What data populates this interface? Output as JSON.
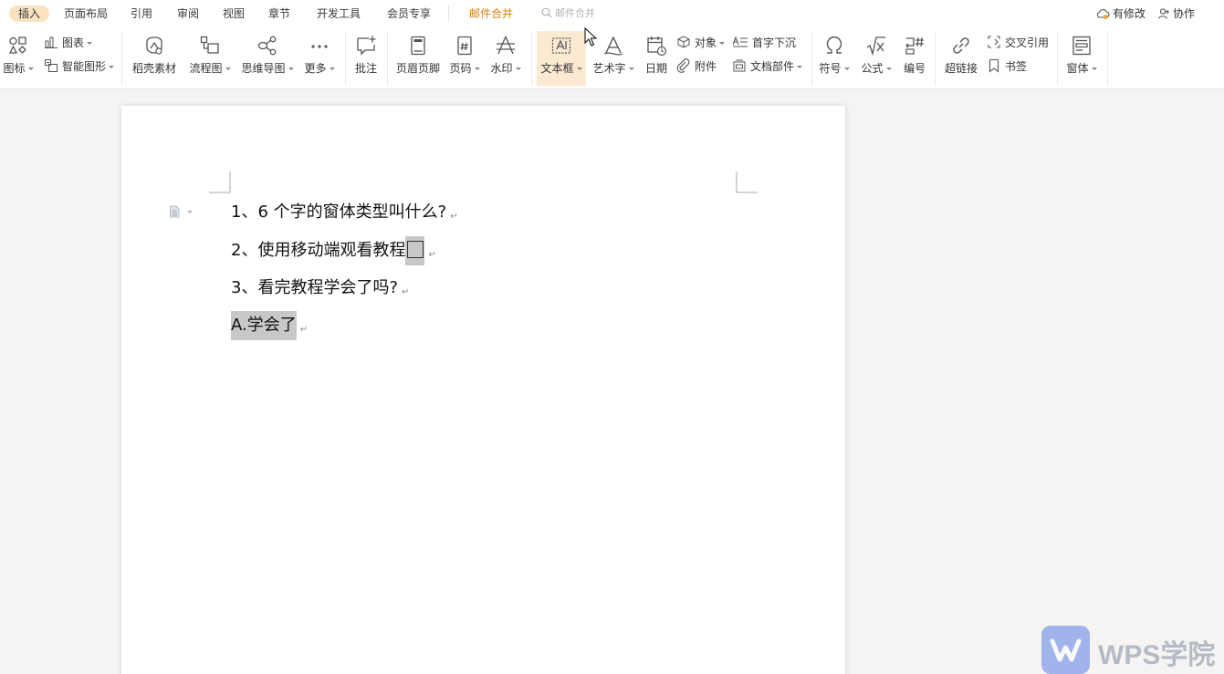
{
  "menu": {
    "tabs": [
      {
        "label": "插入",
        "active": true
      },
      {
        "label": "页面布局"
      },
      {
        "label": "引用"
      },
      {
        "label": "审阅"
      },
      {
        "label": "视图"
      },
      {
        "label": "章节"
      },
      {
        "label": "开发工具"
      },
      {
        "label": "会员专享"
      },
      {
        "label": "邮件合并",
        "accent": true
      }
    ],
    "search_placeholder": "邮件合并",
    "modified_label": "有修改",
    "collab_label": "协作"
  },
  "ribbon": {
    "icon_label": "图标",
    "chart_label": "图表",
    "smartart_label": "智能图形",
    "docer_label": "稻壳素材",
    "flowchart_label": "流程图",
    "mindmap_label": "思维导图",
    "more_label": "更多",
    "comment_label": "批注",
    "header_footer_label": "页眉页脚",
    "page_number_label": "页码",
    "watermark_label": "水印",
    "textbox_label": "文本框",
    "wordart_label": "艺术字",
    "date_label": "日期",
    "object_label": "对象",
    "attachment_label": "附件",
    "dropcap_label": "首字下沉",
    "docparts_label": "文档部件",
    "symbol_label": "符号",
    "formula_label": "公式",
    "numbering_label": "编号",
    "hyperlink_label": "超链接",
    "crossref_label": "交叉引用",
    "bookmark_label": "书签",
    "form_label": "窗体"
  },
  "document": {
    "line1": "1、6 个字的窗体类型叫什么?",
    "line2": "2、使用移动端观看教程",
    "line3": "3、看完教程学会了吗?",
    "line4": "A.学会了",
    "para_mark": "↵"
  },
  "watermark": {
    "text": "WPS学院",
    "color": "#5d7fe6"
  }
}
